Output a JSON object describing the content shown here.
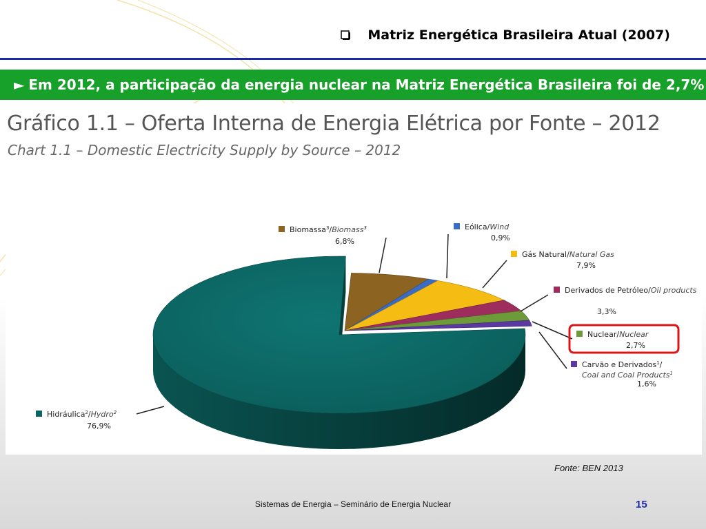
{
  "slide": {
    "title": "Matriz Energética Brasileira Atual (2007)",
    "banner_arrow": "►",
    "banner_text": "Em 2012, a participação da energia nuclear na Matriz Energética Brasileira foi de 2,7%",
    "source": "Fonte: BEN 2013",
    "footer": "Sistemas de Energia – Seminário de Energia Nuclear",
    "page_number": "15"
  },
  "chart_data": {
    "type": "pie",
    "title": "Gráfico 1.1 – Oferta Interna de Energia Elétrica por Fonte – 2012",
    "subtitle": "Chart 1.1 – Domestic Electricity Supply by Source – 2012",
    "unit": "%",
    "highlighted": "Nuclear",
    "slices": [
      {
        "name_pt": "Hidráulica",
        "sup": "2",
        "name_en": "Hydro",
        "sup_en": "2",
        "value": 76.9,
        "label": "76,9%",
        "color": "#0b6663"
      },
      {
        "name_pt": "Biomassa",
        "sup": "3",
        "name_en": "Biomass",
        "sup_en": "3",
        "value": 6.8,
        "label": "6,8%",
        "color": "#8c6320"
      },
      {
        "name_pt": "Eólica",
        "sup": "",
        "name_en": "Wind",
        "sup_en": "",
        "value": 0.9,
        "label": "0,9%",
        "color": "#3b6cc4"
      },
      {
        "name_pt": "Gás Natural",
        "sup": "",
        "name_en": "Natural Gas",
        "sup_en": "",
        "value": 7.9,
        "label": "7,9%",
        "color": "#f5bd14"
      },
      {
        "name_pt": "Derivados de Petróleo",
        "sup": "",
        "name_en": "Oil products",
        "sup_en": "",
        "value": 3.3,
        "label": "3,3%",
        "color": "#9c2d5c"
      },
      {
        "name_pt": "Nuclear",
        "sup": "",
        "name_en": "Nuclear",
        "sup_en": "",
        "value": 2.7,
        "label": "2,7%",
        "color": "#6e9b3a"
      },
      {
        "name_pt": "Carvão e Derivados",
        "sup": "1",
        "name_en": "Coal and Coal Products",
        "sup_en": "1",
        "value": 1.6,
        "label": "1,6%",
        "color": "#5a3aa0"
      }
    ]
  }
}
